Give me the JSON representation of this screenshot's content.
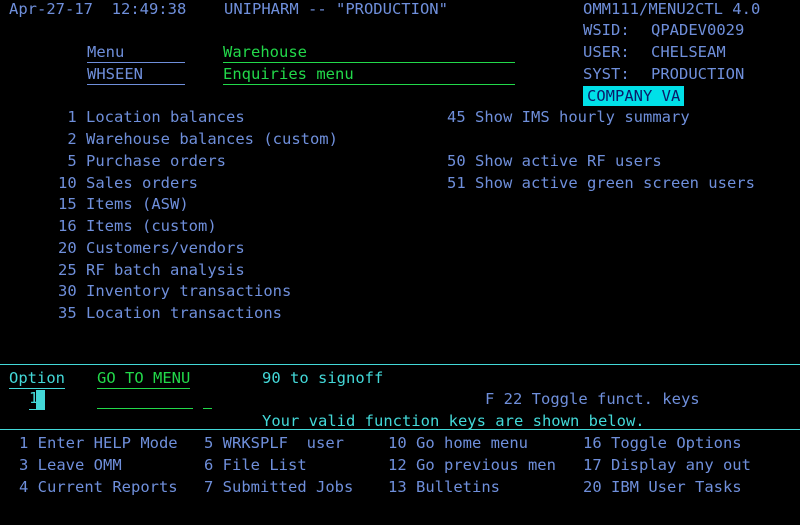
{
  "header": {
    "datetime": "Apr-27-17  12:49:38",
    "system": "UNIPHARM -- \"PRODUCTION\"",
    "program": "OMM111/MENU2CTL 4.0",
    "wsid_label": "WSID:",
    "wsid_value": "QPADEV0029",
    "user_label": "USER:",
    "user_value": "CHELSEAM",
    "syst_label": "SYST:",
    "syst_value": "PRODUCTION",
    "company": "COMPANY VA"
  },
  "title": {
    "menu_label": "Menu",
    "menu_name": "WHSEEN",
    "title1": "Warehouse",
    "title2": "Enquiries menu"
  },
  "menu": {
    "left": [
      {
        "num": " 1",
        "label": "Location balances"
      },
      {
        "num": " 2",
        "label": "Warehouse balances (custom)"
      },
      {
        "num": " 5",
        "label": "Purchase orders"
      },
      {
        "num": "10",
        "label": "Sales orders"
      },
      {
        "num": "15",
        "label": "Items (ASW)"
      },
      {
        "num": "16",
        "label": "Items (custom)"
      },
      {
        "num": "20",
        "label": "Customers/vendors"
      },
      {
        "num": "25",
        "label": "RF batch analysis"
      },
      {
        "num": "30",
        "label": "Inventory transactions"
      },
      {
        "num": "35",
        "label": "Location transactions"
      }
    ],
    "right": [
      {
        "num": "45",
        "label": "Show IMS hourly summary"
      },
      {
        "num": "50",
        "label": "Show active RF users"
      },
      {
        "num": "51",
        "label": "Show active green screen users"
      }
    ]
  },
  "footer": {
    "option_label": "Option",
    "option_value": "1",
    "goto_label": "GO TO MENU",
    "signoff": "90 to signoff",
    "toggle": "F 22 Toggle funct. keys",
    "valid_keys": "Your valid function keys are shown below.",
    "fkeys": [
      [
        "1 Enter HELP Mode",
        "5 WRKSPLF  user",
        "10 Go home menu",
        "16 Toggle Options"
      ],
      [
        "3 Leave OMM",
        "6 File List",
        "12 Go previous men",
        "17 Display any out"
      ],
      [
        "4 Current Reports",
        "7 Submitted Jobs",
        "13 Bulletins",
        "20 IBM User Tasks"
      ]
    ]
  }
}
